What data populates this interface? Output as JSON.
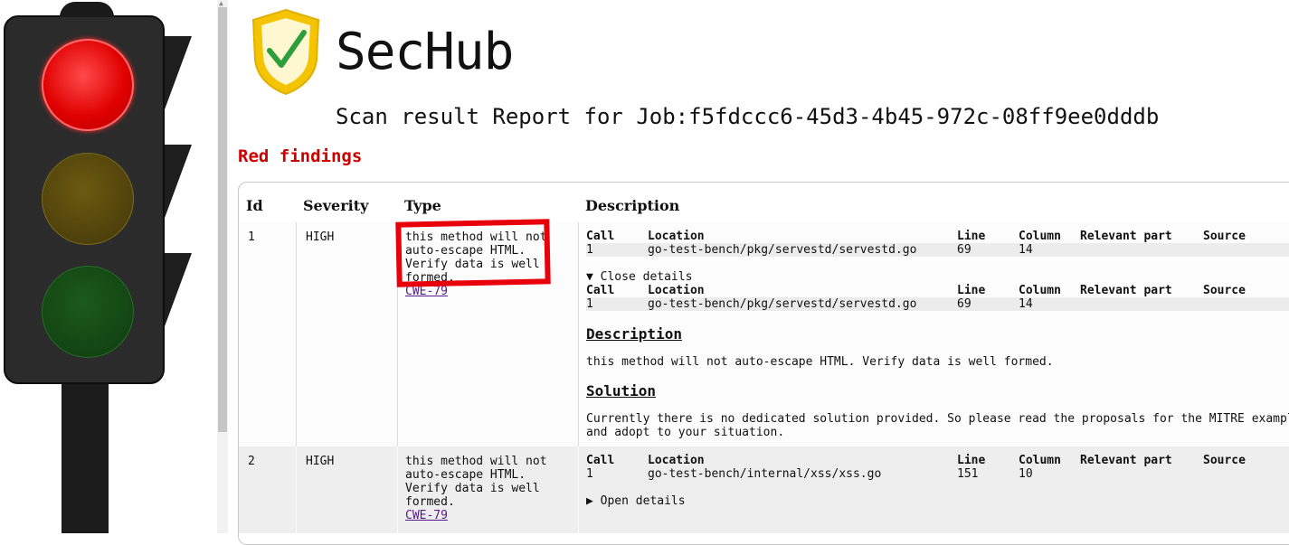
{
  "app": {
    "title": "SecHub",
    "subtitle": "Scan result Report for Job:f5fdccc6-45d3-4b45-972c-08ff9ee0dddb"
  },
  "colors": {
    "red_findings": "#cc0000",
    "traffic_red": "#e00000"
  },
  "section_title": "Red findings",
  "table": {
    "headers": {
      "id": "Id",
      "severity": "Severity",
      "type": "Type",
      "description": "Description"
    },
    "sub_headers": {
      "call": "Call",
      "location": "Location",
      "line": "Line",
      "column": "Column",
      "relevant_part": "Relevant part",
      "source": "Source"
    },
    "rows": [
      {
        "id": "1",
        "severity": "HIGH",
        "type": "this method will not\nauto-escape HTML.\nVerify data is well\nformed.",
        "cwe": "CWE-79",
        "call": "1",
        "location": "go-test-bench/pkg/servestd/servestd.go",
        "line": "69",
        "column": "14",
        "details_toggle": "▼ Close details",
        "detail_call": "1",
        "detail_location": "go-test-bench/pkg/servestd/servestd.go",
        "detail_line": "69",
        "detail_column": "14",
        "description_heading": "Description",
        "description_text": "this method will not auto-escape HTML. Verify data is well formed.",
        "solution_heading": "Solution",
        "solution_text": "Currently there is no dedicated solution provided. So please read the proposals for the MITRE exampl\nand adopt to your situation."
      },
      {
        "id": "2",
        "severity": "HIGH",
        "type": "this method will not\nauto-escape HTML.\nVerify data is well\nformed.",
        "cwe": "CWE-79",
        "call": "1",
        "location": "go-test-bench/internal/xss/xss.go",
        "line": "151",
        "column": "10",
        "details_toggle": "▶ Open details"
      }
    ]
  }
}
